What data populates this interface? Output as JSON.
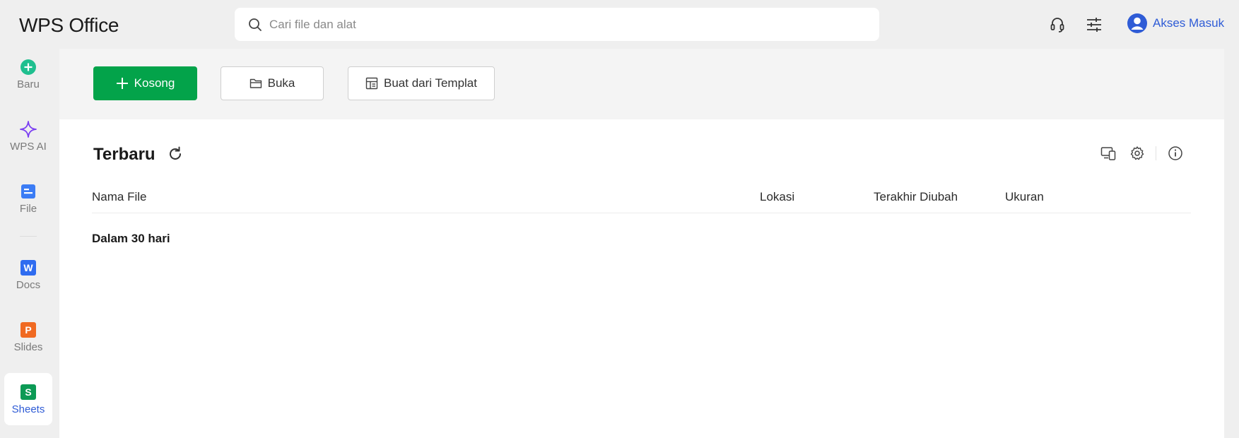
{
  "app": {
    "title": "WPS Office"
  },
  "search": {
    "placeholder": "Cari file dan alat",
    "value": ""
  },
  "topbar": {
    "icons": [
      "headset-icon",
      "sliders-icon"
    ],
    "login_label": "Akses Masuk"
  },
  "sidebar": {
    "items": [
      {
        "label": "Baru",
        "icon": "plus-circle-icon",
        "color": "#1fbf8f"
      },
      {
        "label": "WPS AI",
        "icon": "sparkle-icon",
        "color": "#7b3ff2"
      },
      {
        "label": "File",
        "icon": "file-icon",
        "color": "#3b7cf5"
      },
      {
        "label": "Docs",
        "icon": "docs-w-icon",
        "color": "#2f6cf0"
      },
      {
        "label": "Slides",
        "icon": "slides-p-icon",
        "color": "#f06a22"
      },
      {
        "label": "Sheets",
        "icon": "sheets-s-icon",
        "color": "#0c9a55",
        "active": true
      }
    ]
  },
  "toolbar": {
    "new_blank_label": "Kosong",
    "open_label": "Buka",
    "template_label": "Buat dari Templat"
  },
  "recent": {
    "title": "Terbaru",
    "columns": [
      "Nama File",
      "Lokasi",
      "Terakhir Diubah",
      "Ukuran"
    ],
    "group_label": "Dalam 30 hari",
    "rows": []
  },
  "colors": {
    "accent_blue": "#2f5cd6",
    "primary_green": "#03a34a",
    "background": "#efefef"
  }
}
